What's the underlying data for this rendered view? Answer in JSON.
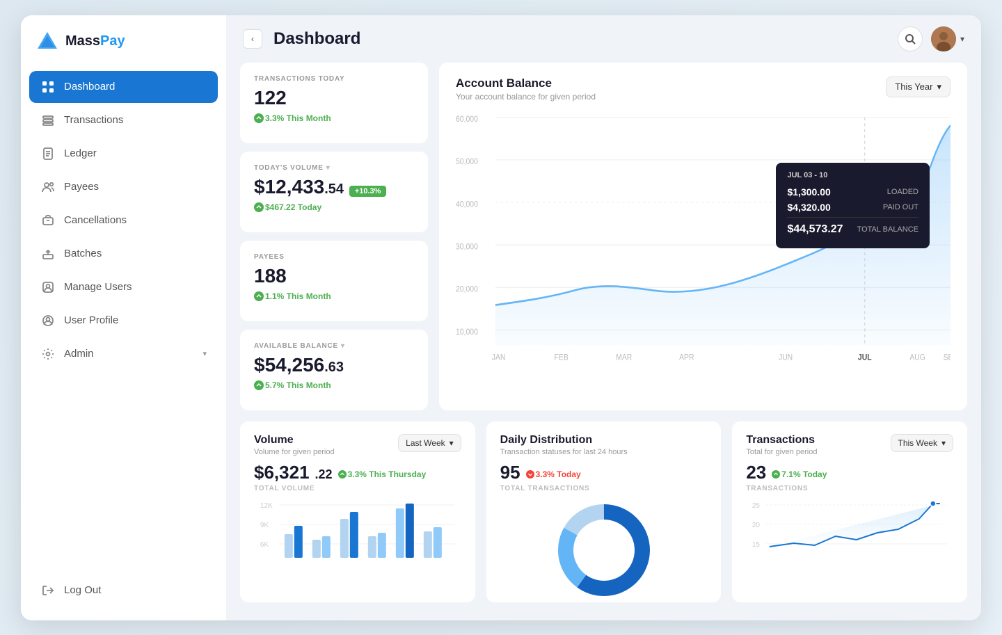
{
  "app": {
    "name": "MassPay",
    "title": "Dashboard"
  },
  "sidebar": {
    "collapse_label": "<",
    "items": [
      {
        "id": "dashboard",
        "label": "Dashboard",
        "icon": "grid",
        "active": true
      },
      {
        "id": "transactions",
        "label": "Transactions",
        "icon": "exchange",
        "active": false
      },
      {
        "id": "ledger",
        "label": "Ledger",
        "icon": "file",
        "active": false
      },
      {
        "id": "payees",
        "label": "Payees",
        "icon": "users",
        "active": false
      },
      {
        "id": "cancellations",
        "label": "Cancellations",
        "icon": "cancel",
        "active": false
      },
      {
        "id": "batches",
        "label": "Batches",
        "icon": "upload",
        "active": false
      },
      {
        "id": "manage-users",
        "label": "Manage Users",
        "icon": "user-manage",
        "active": false
      },
      {
        "id": "user-profile",
        "label": "User Profile",
        "icon": "user-circle",
        "active": false
      },
      {
        "id": "admin",
        "label": "Admin",
        "icon": "gear",
        "active": false,
        "has_arrow": true
      }
    ],
    "logout_label": "Log Out"
  },
  "header": {
    "title": "Dashboard"
  },
  "stats": {
    "transactions_today": {
      "label": "Transactions Today",
      "value": "122",
      "trend": "3.3% This Month",
      "trend_direction": "up"
    },
    "todays_volume": {
      "label": "Today's Volume",
      "value": "$12,433",
      "decimal": ".54",
      "badge": "+10.3%",
      "sub": "$467.22 Today",
      "trend_direction": "up"
    },
    "payees": {
      "label": "Payees",
      "value": "188",
      "trend": "1.1% This Month",
      "trend_direction": "up"
    },
    "available_balance": {
      "label": "Available Balance",
      "value": "$54,256",
      "decimal": ".63",
      "trend": "5.7% This Month",
      "trend_direction": "up",
      "has_dropdown": true
    }
  },
  "account_balance_chart": {
    "title": "Account Balance",
    "subtitle": "Your account balance for given period",
    "period_label": "This Year",
    "x_labels": [
      "JAN",
      "FEB",
      "MAR",
      "APR",
      "JUN",
      "JUL",
      "AUG",
      "SEP"
    ],
    "y_labels": [
      "60,000",
      "50,000",
      "40,000",
      "30,000",
      "20,000",
      "10,000"
    ],
    "tooltip": {
      "date": "JUL 03 - 10",
      "loaded_label": "LOADED",
      "loaded_value": "$1,300.00",
      "paid_out_label": "PAID OUT",
      "paid_out_value": "$4,320.00",
      "total_label": "TOTAL BALANCE",
      "total_value": "$44,573.27"
    }
  },
  "volume_card": {
    "title": "Volume",
    "subtitle": "Volume for given period",
    "period_label": "Last Week",
    "value": "$6,321",
    "decimal": ".22",
    "trend": "3.3% This Thursday",
    "trend_direction": "up",
    "total_label": "Total Volume",
    "y_labels": [
      "12K",
      "9K",
      "6K"
    ]
  },
  "distribution_card": {
    "title": "Daily Distribution",
    "subtitle": "Transaction statuses for last 24 hours",
    "value": "95",
    "trend": "3.3% Today",
    "trend_direction": "down",
    "total_label": "Total Transactions"
  },
  "transactions_card": {
    "title": "Transactions",
    "subtitle": "Total for given period",
    "period_label": "This Week",
    "value": "23",
    "trend": "7.1% Today",
    "trend_direction": "up",
    "total_label": "Transactions",
    "y_labels": [
      "25",
      "20",
      "15"
    ]
  }
}
